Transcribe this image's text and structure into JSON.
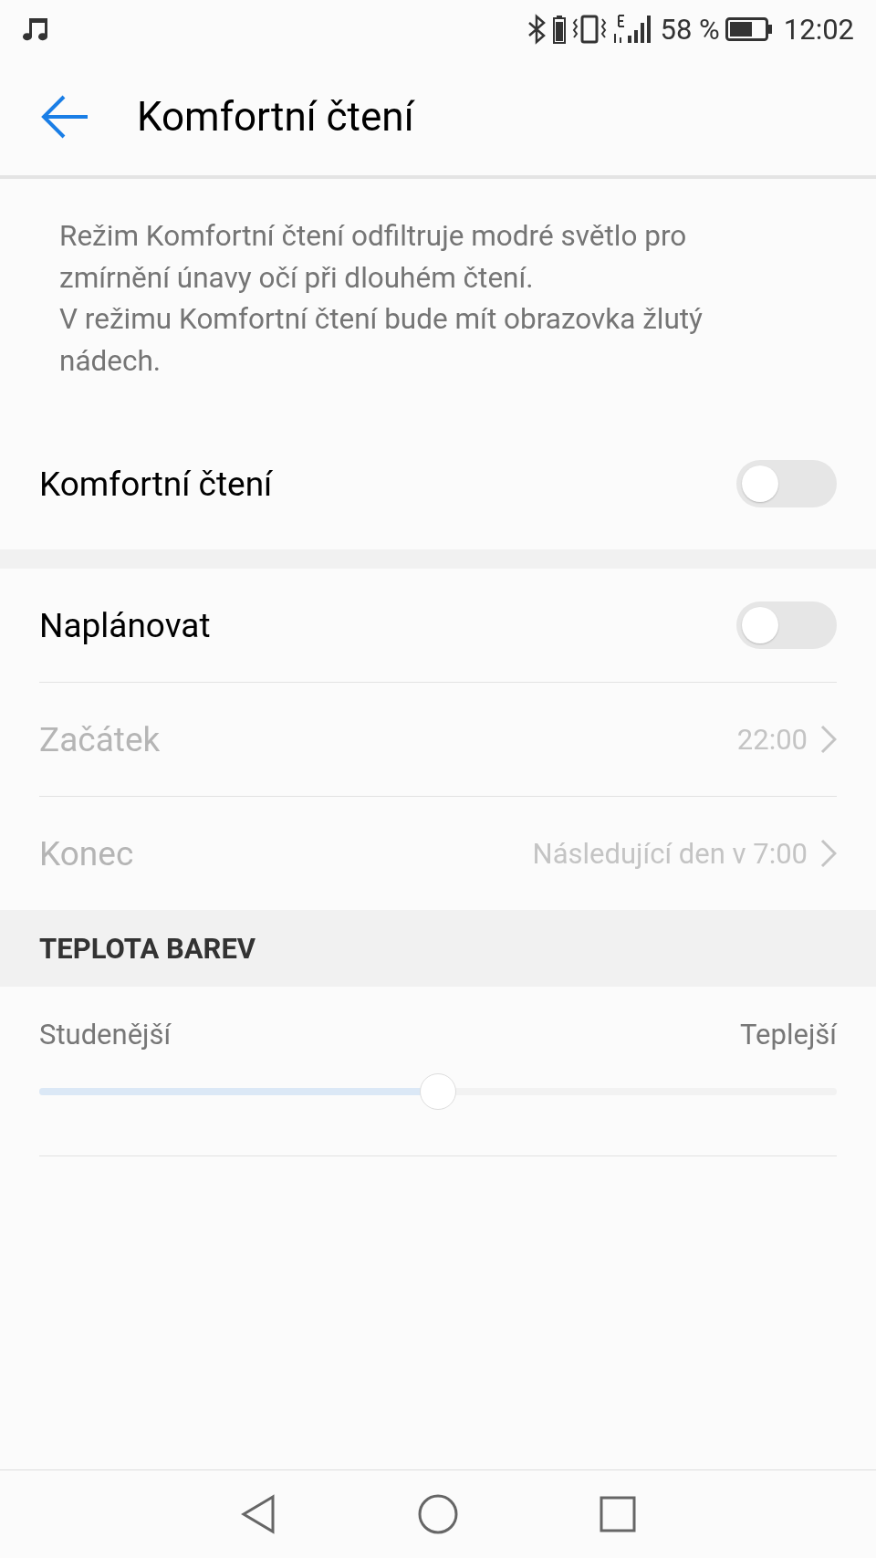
{
  "status_bar": {
    "battery_percent": "58 %",
    "time": "12:02"
  },
  "app_bar": {
    "title": "Komfortní čtení"
  },
  "description": [
    "Režim Komfortní čtení odfiltruje modré světlo pro zmírnění únavy očí při dlouhém čtení.",
    "V režimu Komfortní čtení bude mít obrazovka žlutý nádech."
  ],
  "main_toggle": {
    "label": "Komfortní čtení",
    "on": false
  },
  "schedule": [
    {
      "kind": "toggle",
      "label": "Naplánovat",
      "on": false
    },
    {
      "kind": "link",
      "label": "Začátek",
      "value": "22:00",
      "disabled": true
    },
    {
      "kind": "link",
      "label": "Konec",
      "value": "Následující den v 7:00",
      "disabled": true
    }
  ],
  "color_temperature": {
    "header": "TEPLOTA BAREV",
    "min_label": "Studenější",
    "max_label": "Teplejší",
    "level": 0.5
  }
}
